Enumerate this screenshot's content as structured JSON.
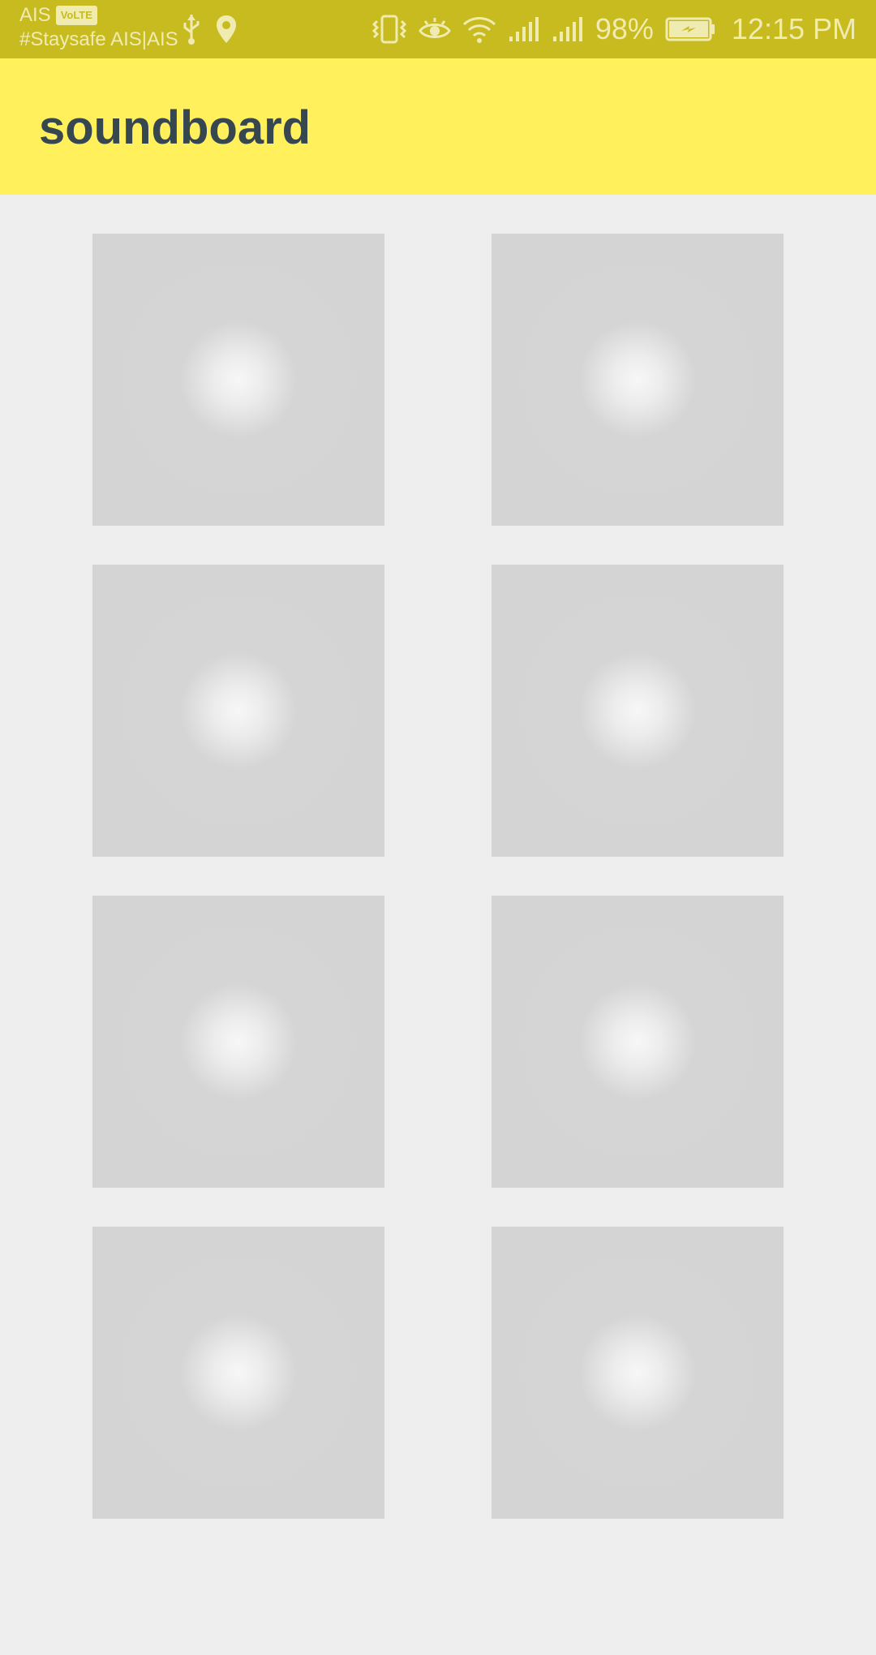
{
  "status_bar": {
    "carrier": "AIS",
    "volte_badge": "VoLTE",
    "network_tag": "#Staysafe AIS|AIS",
    "battery_percent": "98%",
    "time": "12:15 PM",
    "icons": [
      "usb-icon",
      "location-icon",
      "vibrate-icon",
      "eye-comfort-icon",
      "wifi-icon",
      "signal-icon",
      "signal-icon",
      "battery-charging-icon"
    ],
    "color": "#c8bb1f"
  },
  "app_bar": {
    "title": "soundboard",
    "color": "#fff05c"
  },
  "grid": {
    "columns": 2,
    "rows": 4,
    "tiles": [
      {
        "id": 1
      },
      {
        "id": 2
      },
      {
        "id": 3
      },
      {
        "id": 4
      },
      {
        "id": 5
      },
      {
        "id": 6
      },
      {
        "id": 7
      },
      {
        "id": 8
      }
    ],
    "tile_color": "#d4d4d4"
  }
}
